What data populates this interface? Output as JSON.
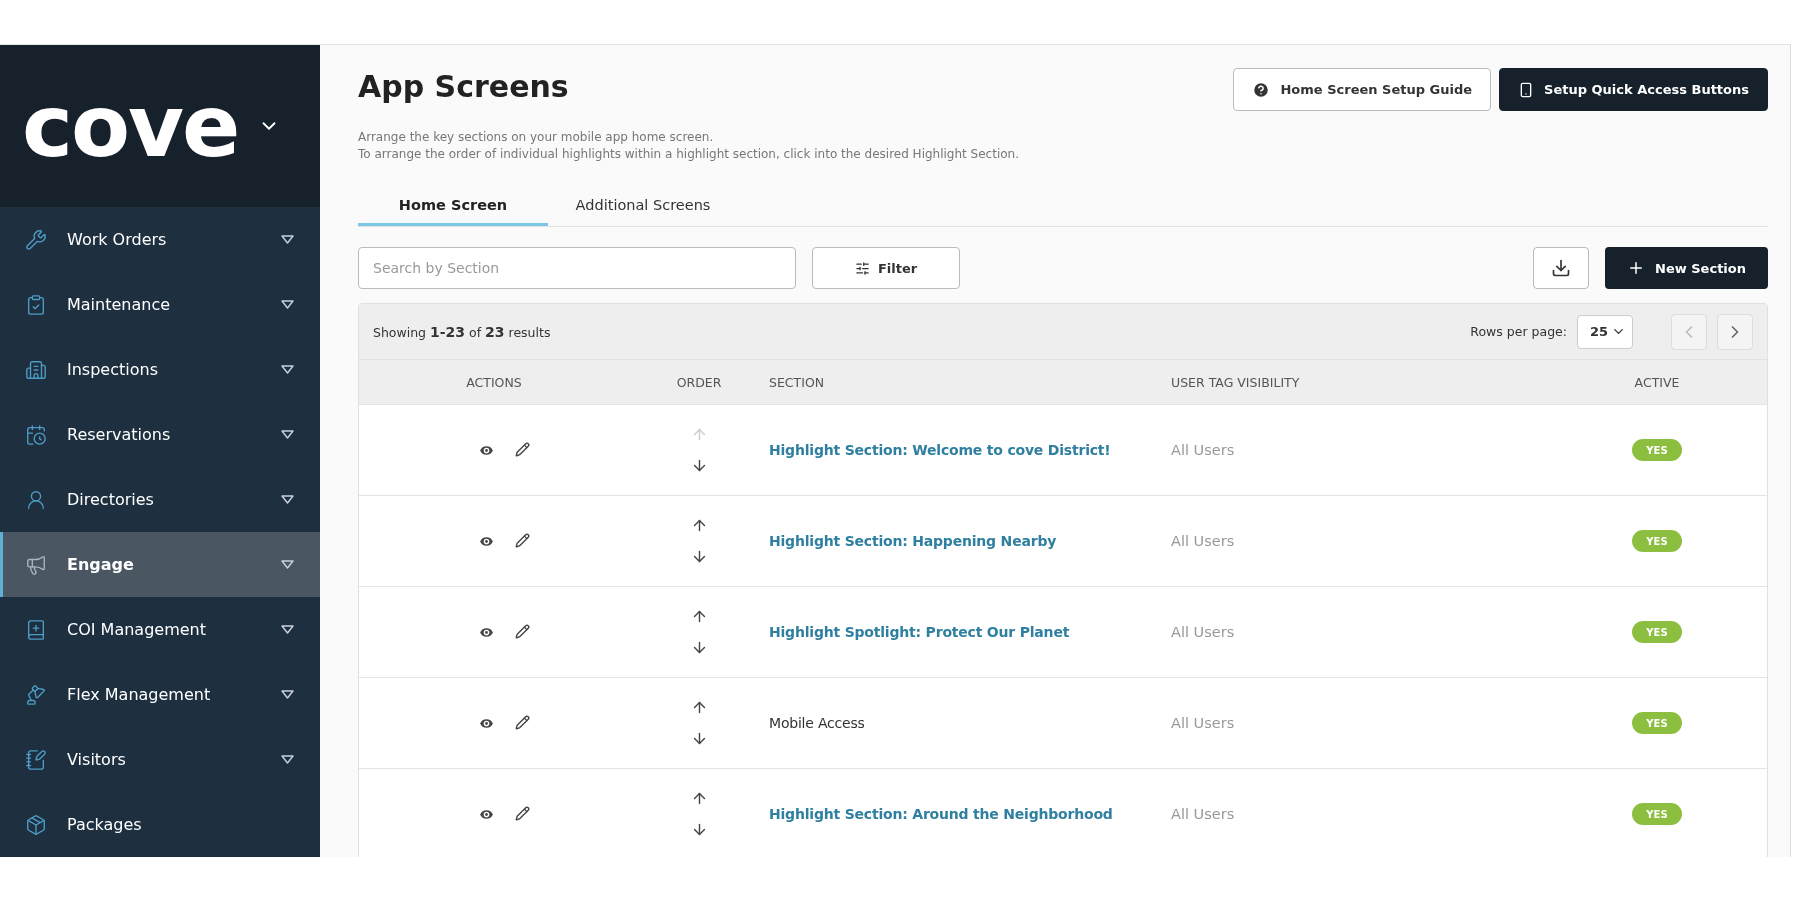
{
  "sidebar": {
    "logo": "cove",
    "items": [
      {
        "label": "Work Orders",
        "selected": false,
        "has_menu": true
      },
      {
        "label": "Maintenance",
        "selected": false,
        "has_menu": true
      },
      {
        "label": "Inspections",
        "selected": false,
        "has_menu": true
      },
      {
        "label": "Reservations",
        "selected": false,
        "has_menu": true
      },
      {
        "label": "Directories",
        "selected": false,
        "has_menu": true
      },
      {
        "label": "Engage",
        "selected": true,
        "has_menu": true
      },
      {
        "label": "COI Management",
        "selected": false,
        "has_menu": true
      },
      {
        "label": "Flex Management",
        "selected": false,
        "has_menu": true
      },
      {
        "label": "Visitors",
        "selected": false,
        "has_menu": true
      },
      {
        "label": "Packages",
        "selected": false,
        "has_menu": false
      }
    ]
  },
  "header": {
    "title": "App Screens",
    "description": [
      "Arrange the key sections on your mobile app home screen.",
      "To arrange the order of individual highlights within a highlight section, click into the desired Highlight Section."
    ],
    "buttons": [
      {
        "label": "Home Screen Setup Guide",
        "kind": "outline"
      },
      {
        "label": "Setup Quick Access Buttons",
        "kind": "primary"
      }
    ]
  },
  "tabs": [
    {
      "label": "Home Screen",
      "selected": true
    },
    {
      "label": "Additional Screens",
      "selected": false
    }
  ],
  "toolbar": {
    "search": {
      "placeholder": "Search by Section"
    },
    "filter": "Filter",
    "new_button": "New Section"
  },
  "table": {
    "summary": "Showing **1-23** of **23** results",
    "rows_per_page_label": "Rows per page:",
    "rows_per_page": "25",
    "prev_disabled": true,
    "next_disabled": false,
    "columns": [
      "ACTIONS",
      "ORDER",
      "SECTION",
      "USER TAG VISIBILITY",
      "ACTIVE"
    ],
    "rows": [
      {
        "section": "Highlight Section: Welcome to cove District!",
        "kind": "link",
        "up_disabled": true,
        "visibility": "All Users",
        "active": "YES"
      },
      {
        "section": "Highlight Section: Happening Nearby",
        "kind": "link",
        "up_disabled": false,
        "visibility": "All Users",
        "active": "YES"
      },
      {
        "section": "Highlight Spotlight: Protect Our Planet",
        "kind": "link",
        "up_disabled": false,
        "visibility": "All Users",
        "active": "YES"
      },
      {
        "section": "Mobile Access",
        "kind": "plain",
        "up_disabled": false,
        "visibility": "All Users",
        "active": "YES"
      },
      {
        "section": "Highlight Section: Around the Neighborhood",
        "kind": "link",
        "up_disabled": false,
        "visibility": "All Users",
        "active": "YES"
      }
    ]
  }
}
